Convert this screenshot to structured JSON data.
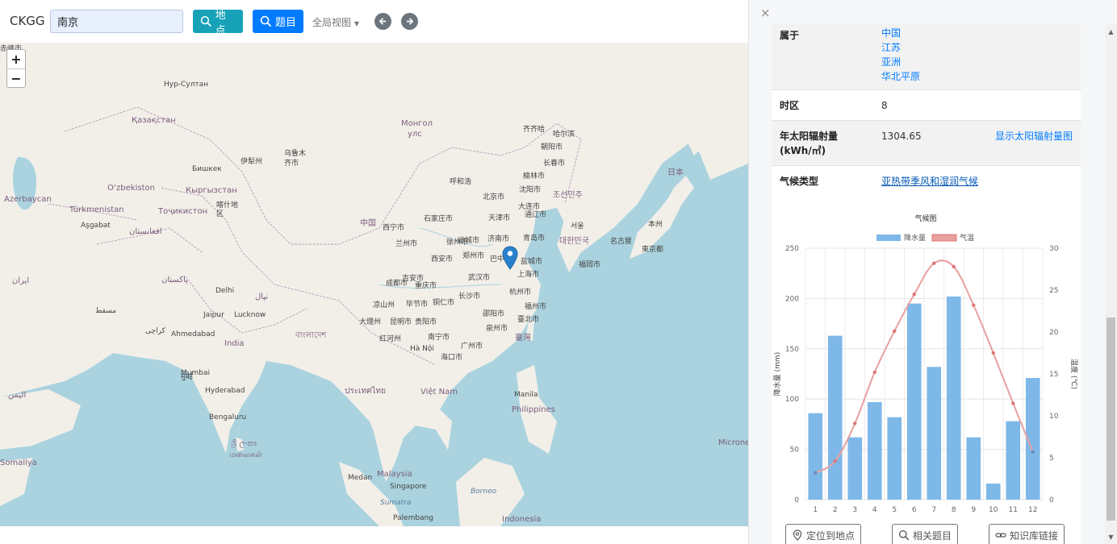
{
  "app": {
    "brand": "CKGG"
  },
  "search": {
    "value": "南京"
  },
  "toolbar": {
    "place_label": "地点",
    "topic_label": "题目",
    "view_label": "全局视图"
  },
  "map": {
    "labels": [
      {
        "t": "Нур-Султан",
        "c": ""
      },
      {
        "t": "Қазақстан",
        "c": "big"
      },
      {
        "t": "Монгол",
        "c": "big"
      },
      {
        "t": "улс",
        "c": "big"
      },
      {
        "t": "乌鲁木",
        "c": ""
      },
      {
        "t": "齐市",
        "c": ""
      },
      {
        "t": "伊犁州",
        "c": ""
      },
      {
        "t": "Бишкек",
        "c": ""
      },
      {
        "t": "Кыргызстан",
        "c": "big"
      },
      {
        "t": "O‘zbekiston",
        "c": "big"
      },
      {
        "t": "Türkmenistan",
        "c": "big"
      },
      {
        "t": "Aşgabat",
        "c": ""
      },
      {
        "t": "Azerbaycan",
        "c": "big"
      },
      {
        "t": "Тоҷикистон",
        "c": "big"
      },
      {
        "t": "喀什地",
        "c": ""
      },
      {
        "t": "区",
        "c": ""
      },
      {
        "t": "افغانستان",
        "c": "big"
      },
      {
        "t": "ایران",
        "c": "big"
      },
      {
        "t": "پاکستان",
        "c": "big"
      },
      {
        "t": "Delhi",
        "c": ""
      },
      {
        "t": "India",
        "c": "big"
      },
      {
        "t": "Ahmedabad",
        "c": ""
      },
      {
        "t": "Mumbai",
        "c": ""
      },
      {
        "t": "Hyderabad",
        "c": ""
      },
      {
        "t": "Bengaluru",
        "c": ""
      },
      {
        "t": "Jaipur",
        "c": ""
      },
      {
        "t": "Lucknow",
        "c": ""
      },
      {
        "t": "中国",
        "c": "big"
      },
      {
        "t": "西宁市",
        "c": ""
      },
      {
        "t": "兰州市",
        "c": ""
      },
      {
        "t": "成都市",
        "c": ""
      },
      {
        "t": "重庆市",
        "c": ""
      },
      {
        "t": "昆明市",
        "c": ""
      },
      {
        "t": "贵阳市",
        "c": ""
      },
      {
        "t": "南宁市",
        "c": ""
      },
      {
        "t": "广州市",
        "c": ""
      },
      {
        "t": "海口市",
        "c": ""
      },
      {
        "t": "长沙市",
        "c": ""
      },
      {
        "t": "武汉市",
        "c": ""
      },
      {
        "t": "郑州市",
        "c": ""
      },
      {
        "t": "西安市",
        "c": ""
      },
      {
        "t": "北京市",
        "c": ""
      },
      {
        "t": "天津市",
        "c": ""
      },
      {
        "t": "济南市",
        "c": ""
      },
      {
        "t": "沈阳市",
        "c": ""
      },
      {
        "t": "长春市",
        "c": ""
      },
      {
        "t": "哈尔滨",
        "c": ""
      },
      {
        "t": "齐齐哈",
        "c": ""
      },
      {
        "t": "呼和浩",
        "c": ""
      },
      {
        "t": "大连市",
        "c": ""
      },
      {
        "t": "青岛市",
        "c": ""
      },
      {
        "t": "盐城市",
        "c": ""
      },
      {
        "t": "上海市",
        "c": ""
      },
      {
        "t": "杭州市",
        "c": ""
      },
      {
        "t": "福州市",
        "c": ""
      },
      {
        "t": "泉州市",
        "c": ""
      },
      {
        "t": "臺北市",
        "c": ""
      },
      {
        "t": "臺灣",
        "c": "big"
      },
      {
        "t": "서울",
        "c": ""
      },
      {
        "t": "대한민국",
        "c": "big"
      },
      {
        "t": "조선민주",
        "c": "big"
      },
      {
        "t": "日本",
        "c": "big"
      },
      {
        "t": "東京都",
        "c": ""
      },
      {
        "t": "名古屋",
        "c": ""
      },
      {
        "t": "福岡市",
        "c": ""
      },
      {
        "t": "本州",
        "c": ""
      },
      {
        "t": "Hà Nội",
        "c": ""
      },
      {
        "t": "Việt Nam",
        "c": "big"
      },
      {
        "t": "ประเทศไทย",
        "c": "big"
      },
      {
        "t": "Manila",
        "c": ""
      },
      {
        "t": "Philippines",
        "c": "big"
      },
      {
        "t": "Malaysia",
        "c": "big"
      },
      {
        "t": "Singapore",
        "c": ""
      },
      {
        "t": "Medan",
        "c": ""
      },
      {
        "t": "Sumatra",
        "c": "sea"
      },
      {
        "t": "Borneo",
        "c": "sea"
      },
      {
        "t": "Palembang",
        "c": ""
      },
      {
        "t": "Indonesia",
        "c": "big"
      },
      {
        "t": "Micrones",
        "c": "big"
      },
      {
        "t": "ශ්‍රී ලංකා",
        "c": "big"
      },
      {
        "t": "மலைகள்",
        "c": "big"
      },
      {
        "t": "اليمن",
        "c": "big"
      },
      {
        "t": "Somaliya",
        "c": "big"
      },
      {
        "t": "مسقط",
        "c": ""
      },
      {
        "t": "کراچی",
        "c": ""
      },
      {
        "t": "نپال",
        "c": "big"
      },
      {
        "t": "বাংলাদেশ",
        "c": "big"
      },
      {
        "t": "मुंबई",
        "c": ""
      },
      {
        "t": "红河州",
        "c": ""
      },
      {
        "t": "大理州",
        "c": ""
      },
      {
        "t": "凉山州",
        "c": ""
      },
      {
        "t": "毕节市",
        "c": ""
      },
      {
        "t": "铜仁市",
        "c": ""
      },
      {
        "t": "邵阳市",
        "c": ""
      },
      {
        "t": "吉安市",
        "c": ""
      },
      {
        "t": "巴中市",
        "c": ""
      },
      {
        "t": "徐州市",
        "c": ""
      },
      {
        "t": "运城市",
        "c": ""
      },
      {
        "t": "石家庄市",
        "c": ""
      },
      {
        "t": "榆林市",
        "c": ""
      },
      {
        "t": "通辽市",
        "c": ""
      },
      {
        "t": "朝阳市",
        "c": ""
      },
      {
        "t": "赤峰市",
        "c": ""
      }
    ]
  },
  "panel": {
    "close": "×",
    "belongs": {
      "key": "属于",
      "values": [
        "中国",
        "江苏",
        "亚洲",
        "华北平原"
      ]
    },
    "timezone": {
      "key": "时区",
      "value": "8"
    },
    "solar": {
      "key1": "年太阳辐射量",
      "key2": "(kWh/㎡)",
      "value": "1304.65",
      "link": "显示太阳辐射量图"
    },
    "climate": {
      "key": "气候类型",
      "value": "亚热带季风和湿润气候"
    },
    "actions": {
      "locate": "定位到地点",
      "related": "相关题目",
      "kb": "知识库链接"
    }
  },
  "colors": {
    "bar": "#7eb8e8",
    "line": "#e8a0a0",
    "teal": "#17a2b8",
    "blue": "#007bff"
  },
  "chart_data": {
    "type": "bar",
    "title": "气候图",
    "categories": [
      "1",
      "2",
      "3",
      "4",
      "5",
      "6",
      "7",
      "8",
      "9",
      "10",
      "11",
      "12"
    ],
    "series": [
      {
        "name": "降水量",
        "type": "bar",
        "axis": "left",
        "values": [
          86,
          163,
          62,
          97,
          82,
          195,
          132,
          202,
          62,
          16,
          78,
          121
        ]
      },
      {
        "name": "气温",
        "type": "line",
        "axis": "right",
        "values": [
          3.2,
          4.6,
          9.1,
          15.2,
          20.1,
          24.5,
          28.2,
          27.8,
          23.2,
          17.5,
          11.5,
          5.7
        ]
      }
    ],
    "ylabel": "降水量 (mm)",
    "y2label": "温度 (℃)",
    "ylim": [
      0,
      250
    ],
    "y2lim": [
      0,
      30
    ],
    "yticks": [
      0,
      50,
      100,
      150,
      200,
      250
    ],
    "y2ticks": [
      0,
      5,
      10,
      15,
      20,
      25,
      30
    ],
    "legend": "top",
    "grid": true
  }
}
